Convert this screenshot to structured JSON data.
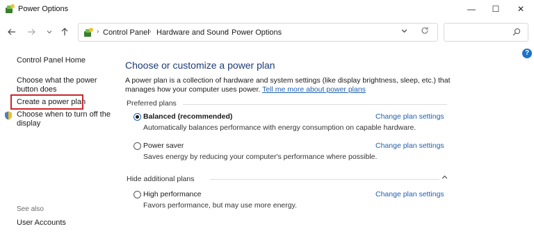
{
  "window": {
    "title": "Power Options",
    "controls": {
      "minimize": "—",
      "maximize": "☐",
      "close": "✕"
    }
  },
  "nav": {
    "breadcrumbs": [
      "Control Panel",
      "Hardware and Sound",
      "Power Options"
    ],
    "separator": "›",
    "search_placeholder": ""
  },
  "sidebar": {
    "home": "Control Panel Home",
    "items": [
      "Choose what the power button does",
      "Create a power plan",
      "Choose when to turn off the display"
    ],
    "see_also_label": "See also",
    "see_also_items": [
      "User Accounts"
    ]
  },
  "main": {
    "heading": "Choose or customize a power plan",
    "intro_text": "A power plan is a collection of hardware and system settings (like display brightness, sleep, etc.) that manages how your computer uses power.",
    "intro_link": "Tell me more about power plans",
    "preferred_label": "Preferred plans",
    "additional_label": "Hide additional plans",
    "plans": [
      {
        "name": "Balanced (recommended)",
        "description": "Automatically balances performance with energy consumption on capable hardware.",
        "link": "Change plan settings",
        "selected": true
      },
      {
        "name": "Power saver",
        "description": "Saves energy by reducing your computer's performance where possible.",
        "link": "Change plan settings",
        "selected": false
      },
      {
        "name": "High performance",
        "description": "Favors performance, but may use more energy.",
        "link": "Change plan settings",
        "selected": false
      }
    ]
  },
  "colors": {
    "heading": "#1c3b78",
    "link": "#1e5fb0",
    "highlight": "#c9252c"
  }
}
